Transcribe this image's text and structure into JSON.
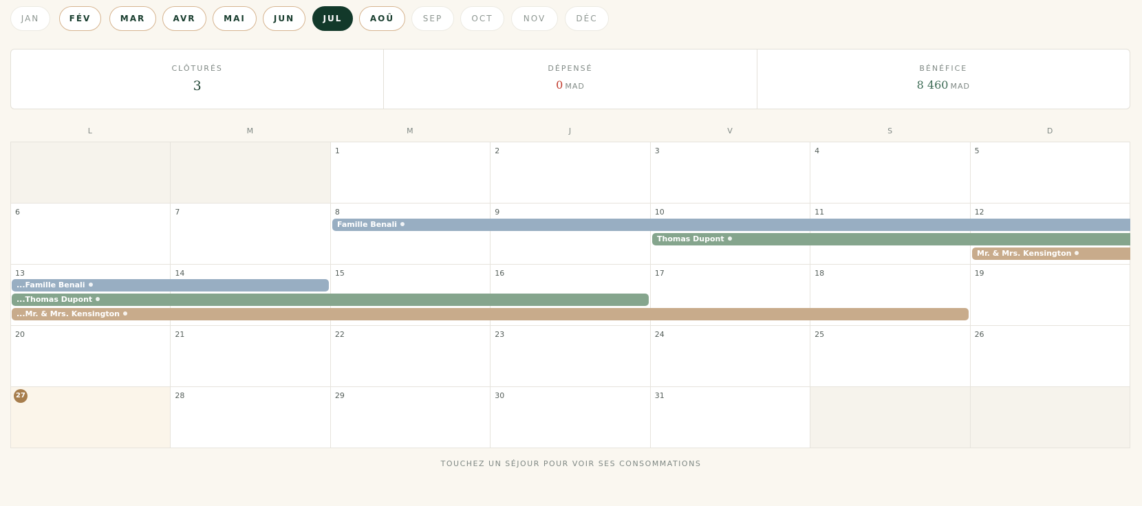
{
  "months": [
    {
      "label": "JAN",
      "state": "inactive"
    },
    {
      "label": "FÉV",
      "state": "active"
    },
    {
      "label": "MAR",
      "state": "active"
    },
    {
      "label": "AVR",
      "state": "active"
    },
    {
      "label": "MAI",
      "state": "active"
    },
    {
      "label": "JUN",
      "state": "active"
    },
    {
      "label": "JUL",
      "state": "current"
    },
    {
      "label": "AOÛ",
      "state": "active"
    },
    {
      "label": "SEP",
      "state": "inactive"
    },
    {
      "label": "OCT",
      "state": "inactive"
    },
    {
      "label": "NOV",
      "state": "inactive"
    },
    {
      "label": "DÉC",
      "state": "inactive"
    }
  ],
  "stats": {
    "closed": {
      "label": "CLÔTURÉS",
      "value": "3"
    },
    "spent": {
      "label": "DÉPENSÉ",
      "value": "0",
      "unit": "MAD"
    },
    "profit": {
      "label": "BÉNÉFICE",
      "value": "8 460",
      "unit": "MAD"
    }
  },
  "weekdays": [
    "L",
    "M",
    "M",
    "J",
    "V",
    "S",
    "D"
  ],
  "calendar": {
    "today": "27",
    "weeks": [
      [
        "",
        "",
        "1",
        "2",
        "3",
        "4",
        "5"
      ],
      [
        "6",
        "7",
        "8",
        "9",
        "10",
        "11",
        "12"
      ],
      [
        "13",
        "14",
        "15",
        "16",
        "17",
        "18",
        "19"
      ],
      [
        "20",
        "21",
        "22",
        "23",
        "24",
        "25",
        "26"
      ],
      [
        "27",
        "28",
        "29",
        "30",
        "31",
        "",
        ""
      ]
    ]
  },
  "bookings": [
    {
      "label": "Famille Benali",
      "color": "#98aec2"
    },
    {
      "label": "Thomas Dupont",
      "color": "#85a58d"
    },
    {
      "label": "Mr. & Mrs. Kensington",
      "color": "#c8ab8b"
    },
    {
      "label": "...Famille Benali",
      "color": "#98aec2"
    },
    {
      "label": "...Thomas Dupont",
      "color": "#85a58d"
    },
    {
      "label": "...Mr. & Mrs. Kensington",
      "color": "#c8ab8b"
    }
  ],
  "footer": {
    "hint": "TOUCHEZ UN SÉJOUR POUR VOIR SES CONSOMMATIONS"
  }
}
